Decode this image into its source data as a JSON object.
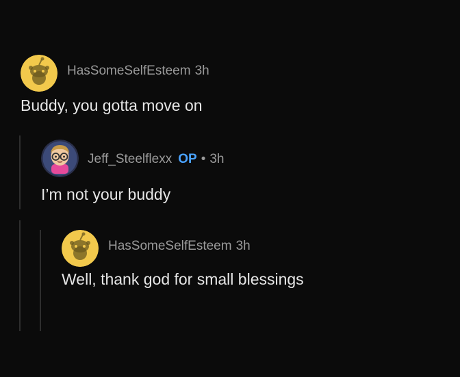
{
  "comments": [
    {
      "username": "HasSomeSelfEsteem",
      "time": "3h",
      "text": "Buddy, you gotta move on",
      "avatar": "snoo-avatar-yellow"
    },
    {
      "username": "Jeff_Steelflexx",
      "badge": "OP",
      "separator": "•",
      "time": "3h",
      "text": "I’m not your buddy",
      "avatar": "custom-avatar-glasses"
    },
    {
      "username": "HasSomeSelfEsteem",
      "time": "3h",
      "text": "Well, thank god for small blessings",
      "avatar": "snoo-avatar-yellow"
    }
  ],
  "colors": {
    "background": "#0b0b0b",
    "username": "#9a9a9a",
    "op_badge": "#4aa3ff",
    "avatar_yellow": "#f2c94c",
    "thread_line": "#2e2e2e"
  }
}
